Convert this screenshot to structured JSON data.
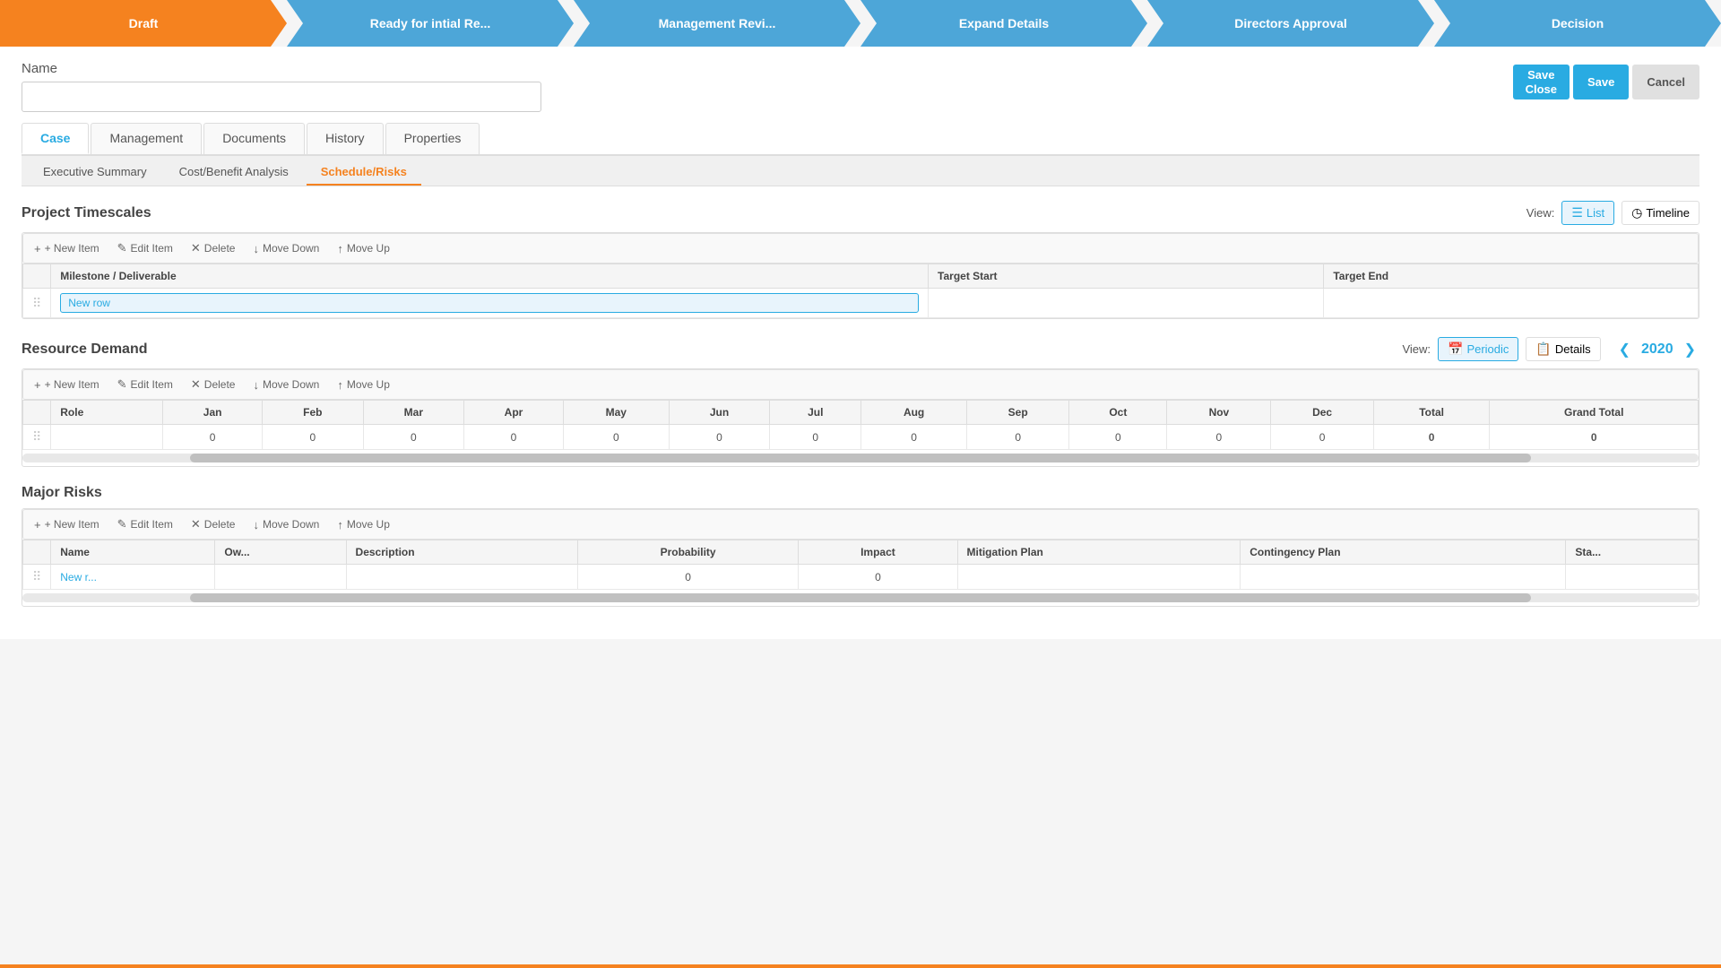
{
  "workflow": {
    "steps": [
      {
        "label": "Draft",
        "state": "active"
      },
      {
        "label": "Ready for intial Re...",
        "state": "inactive"
      },
      {
        "label": "Management Revi...",
        "state": "inactive"
      },
      {
        "label": "Expand Details",
        "state": "inactive"
      },
      {
        "label": "Directors Approval",
        "state": "inactive"
      },
      {
        "label": "Decision",
        "state": "inactive"
      }
    ]
  },
  "name_label": "Name",
  "name_input_value": "",
  "buttons": {
    "save_close": "Save\nClose",
    "save": "Save",
    "cancel": "Cancel"
  },
  "tabs_primary": [
    {
      "label": "Case",
      "active": true
    },
    {
      "label": "Management",
      "active": false
    },
    {
      "label": "Documents",
      "active": false
    },
    {
      "label": "History",
      "active": false
    },
    {
      "label": "Properties",
      "active": false
    }
  ],
  "tabs_secondary": [
    {
      "label": "Executive Summary",
      "active": false
    },
    {
      "label": "Cost/Benefit Analysis",
      "active": false
    },
    {
      "label": "Schedule/Risks",
      "active": true
    }
  ],
  "project_timescales": {
    "title": "Project Timescales",
    "view_label": "View:",
    "view_list": "List",
    "view_timeline": "Timeline",
    "toolbar": {
      "new_item": "+ New Item",
      "edit_item": "Edit Item",
      "delete": "Delete",
      "move_down": "Move Down",
      "move_up": "Move Up"
    },
    "columns": [
      "Milestone / Deliverable",
      "Target Start",
      "Target End"
    ],
    "rows": [
      {
        "drag": true,
        "milestone": "New row",
        "target_start": "",
        "target_end": ""
      }
    ]
  },
  "resource_demand": {
    "title": "Resource Demand",
    "view_label": "View:",
    "view_periodic": "Periodic",
    "view_details": "Details",
    "year": "2020",
    "toolbar": {
      "new_item": "+ New Item",
      "edit_item": "Edit Item",
      "delete": "Delete",
      "move_down": "Move Down",
      "move_up": "Move Up"
    },
    "columns": [
      "Role",
      "Jan",
      "Feb",
      "Mar",
      "Apr",
      "May",
      "Jun",
      "Jul",
      "Aug",
      "Sep",
      "Oct",
      "Nov",
      "Dec",
      "Total",
      "Grand Total"
    ],
    "rows": [
      {
        "drag": true,
        "role": "",
        "jan": "0",
        "feb": "0",
        "mar": "0",
        "apr": "0",
        "may": "0",
        "jun": "0",
        "jul": "0",
        "aug": "0",
        "sep": "0",
        "oct": "0",
        "nov": "0",
        "dec": "0",
        "total": "0",
        "grand_total": "0"
      }
    ]
  },
  "major_risks": {
    "title": "Major Risks",
    "toolbar": {
      "new_item": "+ New Item",
      "edit_item": "Edit Item",
      "delete": "Delete",
      "move_down": "Move Down",
      "move_up": "Move Up"
    },
    "columns": [
      "Name",
      "Ow...",
      "Description",
      "Probability",
      "Impact",
      "Mitigation Plan",
      "Contingency Plan",
      "Sta..."
    ],
    "rows": [
      {
        "drag": true,
        "name": "New r...",
        "owner": "",
        "description": "",
        "probability": "0",
        "impact": "0",
        "mitigation": "",
        "contingency": "",
        "status": ""
      }
    ]
  },
  "icons": {
    "list_icon": "☰",
    "timeline_icon": "◷",
    "periodic_icon": "📅",
    "details_icon": "📋",
    "new_icon": "+",
    "edit_icon": "✎",
    "delete_icon": "✕",
    "move_down_icon": "↓",
    "move_up_icon": "↑",
    "drag_icon": "⠿",
    "chevron_left": "❮",
    "chevron_right": "❯"
  }
}
